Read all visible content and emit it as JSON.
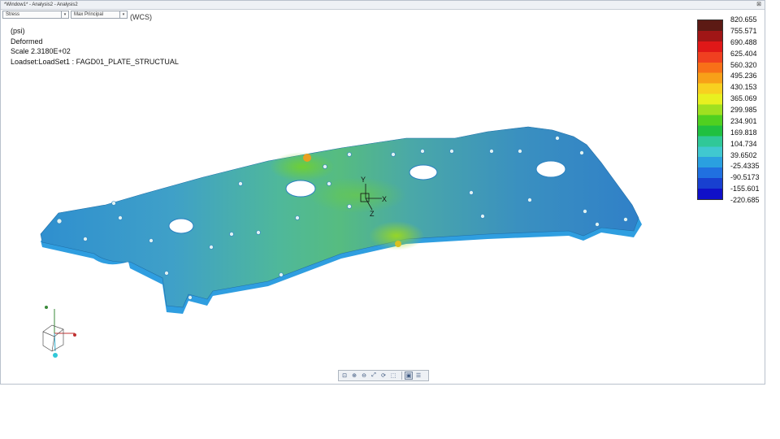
{
  "window": {
    "title": "*Window1* - Analysis2 - Analysis2",
    "close_glyph": "⊠"
  },
  "controls": {
    "result_type": "Stress",
    "component": "Max Principal"
  },
  "csys_label": "(WCS)",
  "info": {
    "units": "(psi)",
    "mode": "Deformed",
    "scale": "Scale  2.3180E+02",
    "loadset": "Loadset:LoadSet1 :  FAGD01_PLATE_STRUCTUAL"
  },
  "legend": {
    "values": [
      "820.655",
      "755.571",
      "690.488",
      "625.404",
      "560.320",
      "495.236",
      "430.153",
      "365.069",
      "299.985",
      "234.901",
      "169.818",
      "104.734",
      "39.6502",
      "-25.4335",
      "-90.5173",
      "-155.601",
      "-220.685"
    ],
    "colors": [
      "#5c1a14",
      "#a01616",
      "#e01818",
      "#f04020",
      "#f87018",
      "#f8a018",
      "#f8d020",
      "#e8f020",
      "#a0e020",
      "#50d020",
      "#20c040",
      "#30c898",
      "#40c8d0",
      "#2aa0e0",
      "#2070e0",
      "#1840d0",
      "#1010c8"
    ]
  },
  "triad": {
    "x": "X",
    "y": "Y",
    "z": "Z"
  },
  "toolbar": {
    "buttons": [
      {
        "name": "refit-icon",
        "glyph": "⊡"
      },
      {
        "name": "zoom-window-icon",
        "glyph": "⊕"
      },
      {
        "name": "zoom-out-icon",
        "glyph": "⊖"
      },
      {
        "name": "pan-icon",
        "glyph": "⤢"
      },
      {
        "name": "spin-icon",
        "glyph": "⟳"
      },
      {
        "name": "view-orient-icon",
        "glyph": "⬚"
      },
      {
        "name": "display-style-icon",
        "glyph": "▣"
      },
      {
        "name": "legend-toggle-icon",
        "glyph": "☰"
      }
    ]
  }
}
